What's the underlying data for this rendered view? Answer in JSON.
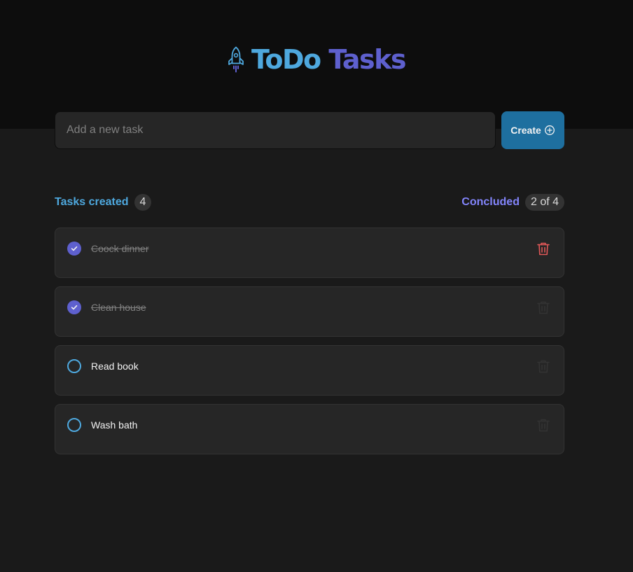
{
  "header": {
    "title_part1": "ToDo",
    "title_part2": "Tasks",
    "logo_icon": "rocket-icon"
  },
  "new_task": {
    "placeholder": "Add a new task",
    "value": "",
    "create_label": "Create",
    "create_icon": "plus-circle-icon"
  },
  "counters": {
    "created_label": "Tasks created",
    "created_count": "4",
    "concluded_label": "Concluded",
    "concluded_count": "2 of 4"
  },
  "tasks": [
    {
      "text": "Coock dinner",
      "done": true
    },
    {
      "text": "Clean house",
      "done": true
    },
    {
      "text": "Read book",
      "done": false
    },
    {
      "text": "Wash bath",
      "done": false
    }
  ],
  "colors": {
    "brand_blue": "#4ea8de",
    "brand_purple": "#5e60ce",
    "purple_light": "#8284fa",
    "button_blue": "#1e6f9f",
    "danger_red": "#e25858"
  }
}
